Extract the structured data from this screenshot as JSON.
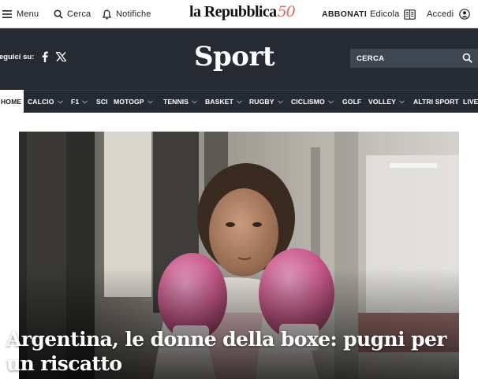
{
  "topbar": {
    "menu_label": "Menu",
    "search_label": "Cerca",
    "notifications_label": "Notifiche",
    "logo_text": "la Repubblica",
    "logo_anniversary": "50",
    "subscribe_label": "ABBONATI",
    "edicola_label": "Edicola",
    "login_label": "Accedi"
  },
  "section": {
    "follow_label": "eguici su:",
    "title": "Sport",
    "search_placeholder": "CERCA"
  },
  "nav": {
    "items": [
      {
        "label": "HOME",
        "dropdown": false,
        "active": true
      },
      {
        "label": "CALCIO",
        "dropdown": true
      },
      {
        "label": "F1",
        "dropdown": true
      },
      {
        "label": "SCI",
        "dropdown": false
      },
      {
        "label": "MOTOGP",
        "dropdown": true
      },
      {
        "label": "TENNIS",
        "dropdown": true
      },
      {
        "label": "BASKET",
        "dropdown": true
      },
      {
        "label": "RUGBY",
        "dropdown": true
      },
      {
        "label": "CICLISMO",
        "dropdown": true
      },
      {
        "label": "GOLF",
        "dropdown": false
      },
      {
        "label": "VOLLEY",
        "dropdown": true
      },
      {
        "label": "ALTRI SPORT",
        "dropdown": false
      },
      {
        "label": "LIVE",
        "dropdown": false
      }
    ]
  },
  "hero": {
    "headline": "Argentina, le donne della boxe: pugni per un riscatto"
  },
  "colors": {
    "section_bg": "#262b33",
    "search_box_bg": "#3e4651",
    "logo_accent": "#e06a5a",
    "glove_pink": "#c85a8a"
  },
  "icons": [
    "hamburger-icon",
    "search-icon",
    "bell-icon",
    "newspaper-icon",
    "user-icon",
    "facebook-icon",
    "x-icon",
    "chevron-down-icon"
  ]
}
